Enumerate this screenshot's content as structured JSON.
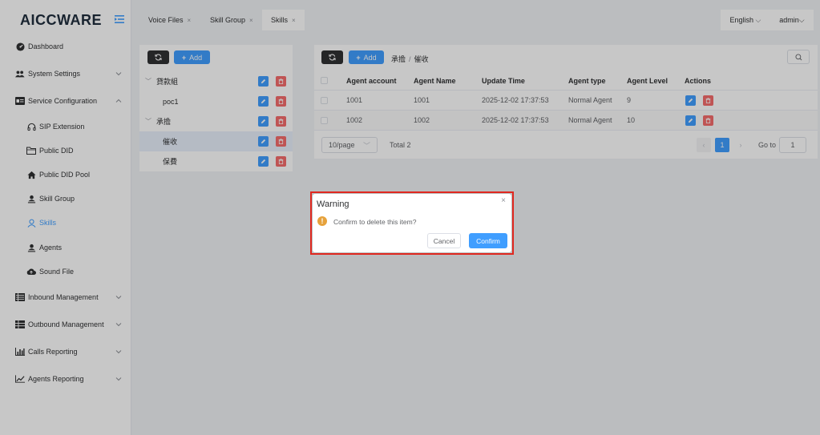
{
  "sidebar": {
    "logo": "AICCWARE",
    "items": [
      {
        "label": "Dashboard",
        "icon": "dashboard-icon",
        "type": "top"
      },
      {
        "label": "System Settings",
        "icon": "users-icon",
        "type": "top",
        "expandable": true
      },
      {
        "label": "Service Configuration",
        "icon": "id-card-icon",
        "type": "top",
        "expanded": true
      },
      {
        "label": "SIP Extension",
        "icon": "headset-icon",
        "type": "sub"
      },
      {
        "label": "Public DID",
        "icon": "folder-icon",
        "type": "sub"
      },
      {
        "label": "Public DID Pool",
        "icon": "home-icon",
        "type": "sub"
      },
      {
        "label": "Skill Group",
        "icon": "user-upload-icon",
        "type": "sub"
      },
      {
        "label": "Skills",
        "icon": "user-outline-icon",
        "type": "sub",
        "active": true
      },
      {
        "label": "Agents",
        "icon": "user-icon",
        "type": "sub"
      },
      {
        "label": "Sound File",
        "icon": "cloud-upload-icon",
        "type": "sub"
      },
      {
        "label": "Inbound Management",
        "icon": "list-icon",
        "type": "top",
        "expandable": true
      },
      {
        "label": "Outbound Management",
        "icon": "table-icon",
        "type": "top",
        "expandable": true
      },
      {
        "label": "Calls Reporting",
        "icon": "bar-chart-icon",
        "type": "top",
        "expandable": true
      },
      {
        "label": "Agents Reporting",
        "icon": "line-chart-icon",
        "type": "top",
        "expandable": true
      }
    ]
  },
  "tabs": [
    {
      "label": "Voice Files",
      "active": false
    },
    {
      "label": "Skill Group",
      "active": false
    },
    {
      "label": "Skills",
      "active": true
    }
  ],
  "header": {
    "language": "English",
    "user": "admin"
  },
  "tree": {
    "add_label": "Add",
    "nodes": [
      {
        "label": "貸款組",
        "level": 0,
        "expanded": true
      },
      {
        "label": "poc1",
        "level": 1
      },
      {
        "label": "承擔",
        "level": 0,
        "expanded": true
      },
      {
        "label": "催收",
        "level": 1,
        "selected": true
      },
      {
        "label": "保費",
        "level": 1
      }
    ]
  },
  "table": {
    "add_label": "Add",
    "breadcrumb": [
      "承擔",
      "催收"
    ],
    "columns": [
      "Agent account",
      "Agent Name",
      "Update Time",
      "Agent type",
      "Agent Level",
      "Actions"
    ],
    "rows": [
      {
        "account": "1001",
        "name": "1001",
        "updated": "2025-12-02 17:37:53",
        "type": "Normal Agent",
        "level": "9"
      },
      {
        "account": "1002",
        "name": "1002",
        "updated": "2025-12-02 17:37:53",
        "type": "Normal Agent",
        "level": "10"
      }
    ],
    "pager": {
      "page_size": "10/page",
      "total": "Total 2",
      "current_page": "1",
      "goto_label": "Go to",
      "goto_value": "1"
    }
  },
  "dialog": {
    "title": "Warning",
    "message": "Confirm to delete this item?",
    "cancel": "Cancel",
    "confirm": "Confirm"
  },
  "colors": {
    "primary": "#409eff",
    "danger": "#f56c6c",
    "warning": "#e6a23c",
    "highlight": "#e0281f"
  }
}
